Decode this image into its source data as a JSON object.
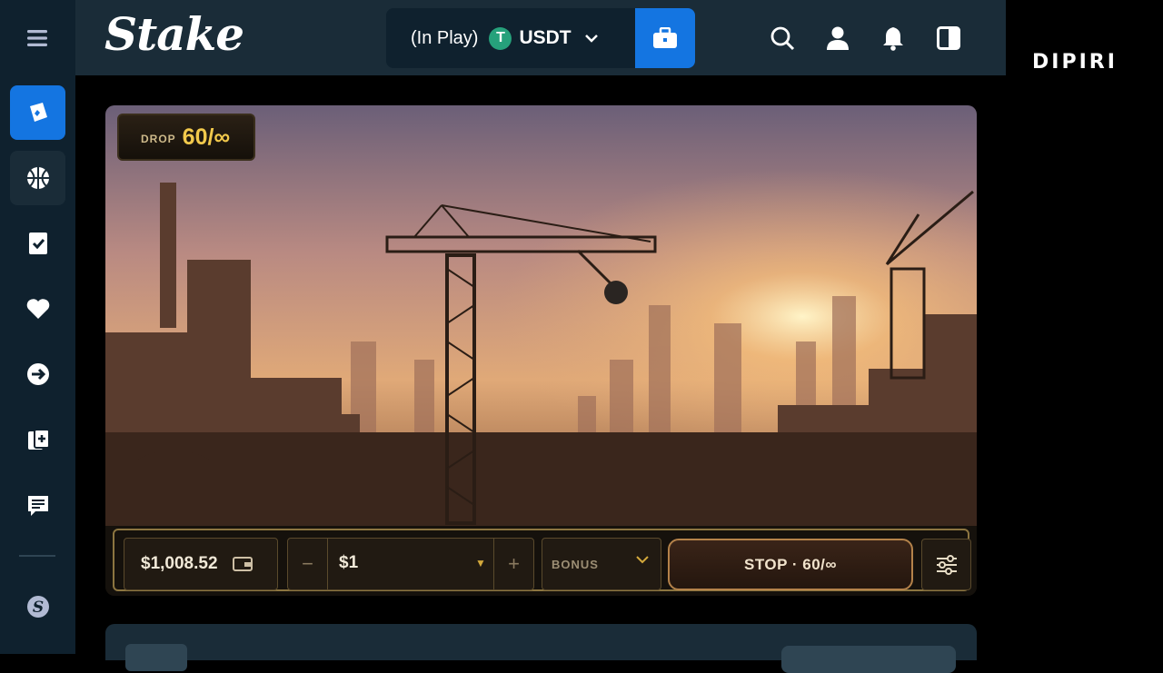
{
  "header": {
    "logo": "Stake",
    "wallet_status": "(In Play)",
    "currency_symbol": "T",
    "currency": "USDT"
  },
  "watermark": "DIPIRI",
  "sidebar": {
    "items": [
      {
        "name": "casino",
        "icon": "cards-icon",
        "active": true
      },
      {
        "name": "sports",
        "icon": "basketball-icon",
        "active": false
      },
      {
        "name": "bets",
        "icon": "checklist-icon"
      },
      {
        "name": "favourites",
        "icon": "heart-icon"
      },
      {
        "name": "recent",
        "icon": "arrow-right-icon"
      },
      {
        "name": "challenges",
        "icon": "cards-plus-icon"
      },
      {
        "name": "my-bets",
        "icon": "notes-icon"
      },
      {
        "name": "stake-originals",
        "icon": "stake-s-icon"
      }
    ]
  },
  "game": {
    "drop_label": "DROP",
    "drop_value": "60/∞",
    "balance": "$1,008.52",
    "bet_amount": "$1",
    "bonus_label": "BONUS",
    "stop_label": "STOP · 60/∞"
  },
  "colors": {
    "sidebar_bg": "#0f212e",
    "header_bg": "#1a2c38",
    "accent_blue": "#1475e1",
    "gold": "#f2c94c",
    "tether_green": "#26a17b"
  }
}
